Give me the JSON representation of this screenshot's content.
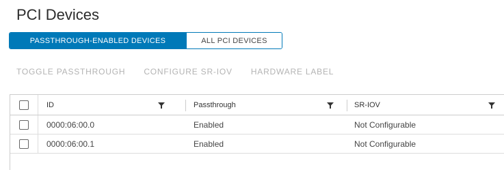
{
  "page": {
    "title": "PCI Devices"
  },
  "tabs": [
    {
      "label": "PASSTHROUGH-ENABLED DEVICES",
      "selected": true
    },
    {
      "label": "ALL PCI DEVICES",
      "selected": false
    }
  ],
  "toolbar": {
    "toggle_passthrough": "TOGGLE PASSTHROUGH",
    "configure_sriov": "CONFIGURE SR-IOV",
    "hardware_label": "HARDWARE LABEL"
  },
  "table": {
    "columns": [
      "ID",
      "Passthrough",
      "SR-IOV"
    ],
    "rows": [
      {
        "id": "0000:06:00.0",
        "passthrough": "Enabled",
        "sriov": "Not Configurable"
      },
      {
        "id": "0000:06:00.1",
        "passthrough": "Enabled",
        "sriov": "Not Configurable"
      }
    ]
  },
  "colors": {
    "accent": "#0079b8",
    "disabled_text": "#b3b3b3"
  },
  "icons": {
    "filter": "filter-icon"
  }
}
